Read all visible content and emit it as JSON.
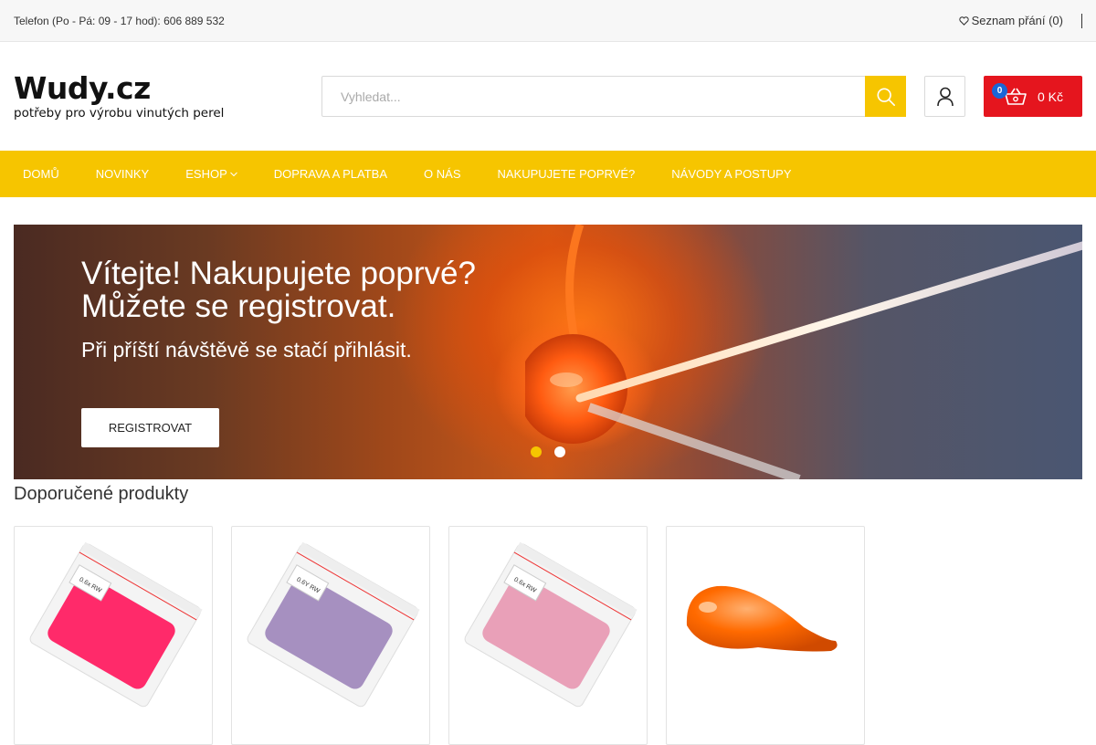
{
  "topbar": {
    "phone": "Telefon (Po - Pá: 09 - 17 hod): 606 889 532",
    "wishlist": "Seznam přání (0)",
    "wishlist_icon": "heart-outline-icon"
  },
  "header": {
    "logo_title": "Wudy.cz",
    "logo_subtitle": "potřeby pro výrobu vinutých perel",
    "search_placeholder": "Vyhledat...",
    "search_icon": "search-icon",
    "account_icon": "user-icon",
    "cart": {
      "count": "0",
      "total": "0 Kč",
      "icon": "basket-icon"
    }
  },
  "nav": {
    "items": [
      {
        "label": "DOMŮ"
      },
      {
        "label": "NOVINKY"
      },
      {
        "label": "ESHOP",
        "has_dropdown": true
      },
      {
        "label": "DOPRAVA A PLATBA"
      },
      {
        "label": "O NÁS"
      },
      {
        "label": "NAKUPUJETE POPRVÉ?"
      },
      {
        "label": "NÁVODY A POSTUPY"
      }
    ]
  },
  "hero": {
    "title_line1": "Vítejte! Nakupujete poprvé?",
    "title_line2": "Můžete se registrovat.",
    "subtitle": "Při příští návštěvě se stačí přihlásit.",
    "button": "REGISTROVAT",
    "slides": 2,
    "active_slide": 1
  },
  "featured": {
    "title": "Doporučené produkty",
    "products": [
      {
        "image": "pink-frit-bag",
        "color": "#ff2a6a",
        "bag_label": "0.6x RW"
      },
      {
        "image": "lilac-frit-bag",
        "color": "#a690c0",
        "bag_label": "0.6Y RW"
      },
      {
        "image": "rose-frit-bag",
        "color": "#e9a0b8",
        "bag_label": "0.6x RW"
      },
      {
        "image": "orange-glass-bead",
        "color": "#ff6a00"
      }
    ]
  },
  "colors": {
    "accent": "#f6c500",
    "cart": "#e5151e",
    "badge": "#1a66d6"
  }
}
